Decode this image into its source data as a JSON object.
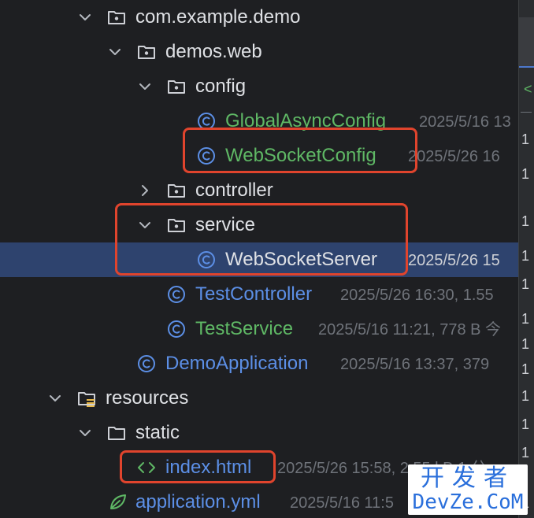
{
  "tree": {
    "items": [
      {
        "name": "com.example.demo",
        "meta": ""
      },
      {
        "name": "demos.web",
        "meta": ""
      },
      {
        "name": "config",
        "meta": ""
      },
      {
        "name": "GlobalAsyncConfig",
        "meta": "2025/5/16 13"
      },
      {
        "name": "WebSocketConfig",
        "meta": "2025/5/26 16"
      },
      {
        "name": "controller",
        "meta": ""
      },
      {
        "name": "service",
        "meta": ""
      },
      {
        "name": "WebSocketServer",
        "meta": "2025/5/26 15"
      },
      {
        "name": "TestController",
        "meta": "2025/5/26 16:30, 1.55"
      },
      {
        "name": "TestService",
        "meta": "2025/5/16 11:21, 778 B 今"
      },
      {
        "name": "DemoApplication",
        "meta": "2025/5/16 13:37, 379"
      },
      {
        "name": "resources",
        "meta": ""
      },
      {
        "name": "static",
        "meta": ""
      },
      {
        "name": "index.html",
        "meta": "2025/5/26 15:58, 2.55 kB 1 分"
      },
      {
        "name": "application.yml",
        "meta": "2025/5/16 11:5"
      }
    ]
  },
  "gutter": {
    "numbers": [
      "1",
      "1",
      "1",
      "1",
      "1",
      "1",
      "1",
      "1",
      "1",
      "1",
      "1",
      "1"
    ]
  },
  "colors": {
    "background": "#1e1f22",
    "selected_row": "#2e436e",
    "highlight_box": "#e0442d",
    "modified_file": "#5fb865",
    "new_file": "#5c8fe6",
    "plain_file": "#dfe1e5",
    "meta_text": "#6f737a"
  },
  "watermark": {
    "line1": "开发者",
    "line2": "DevZe.CoM"
  }
}
